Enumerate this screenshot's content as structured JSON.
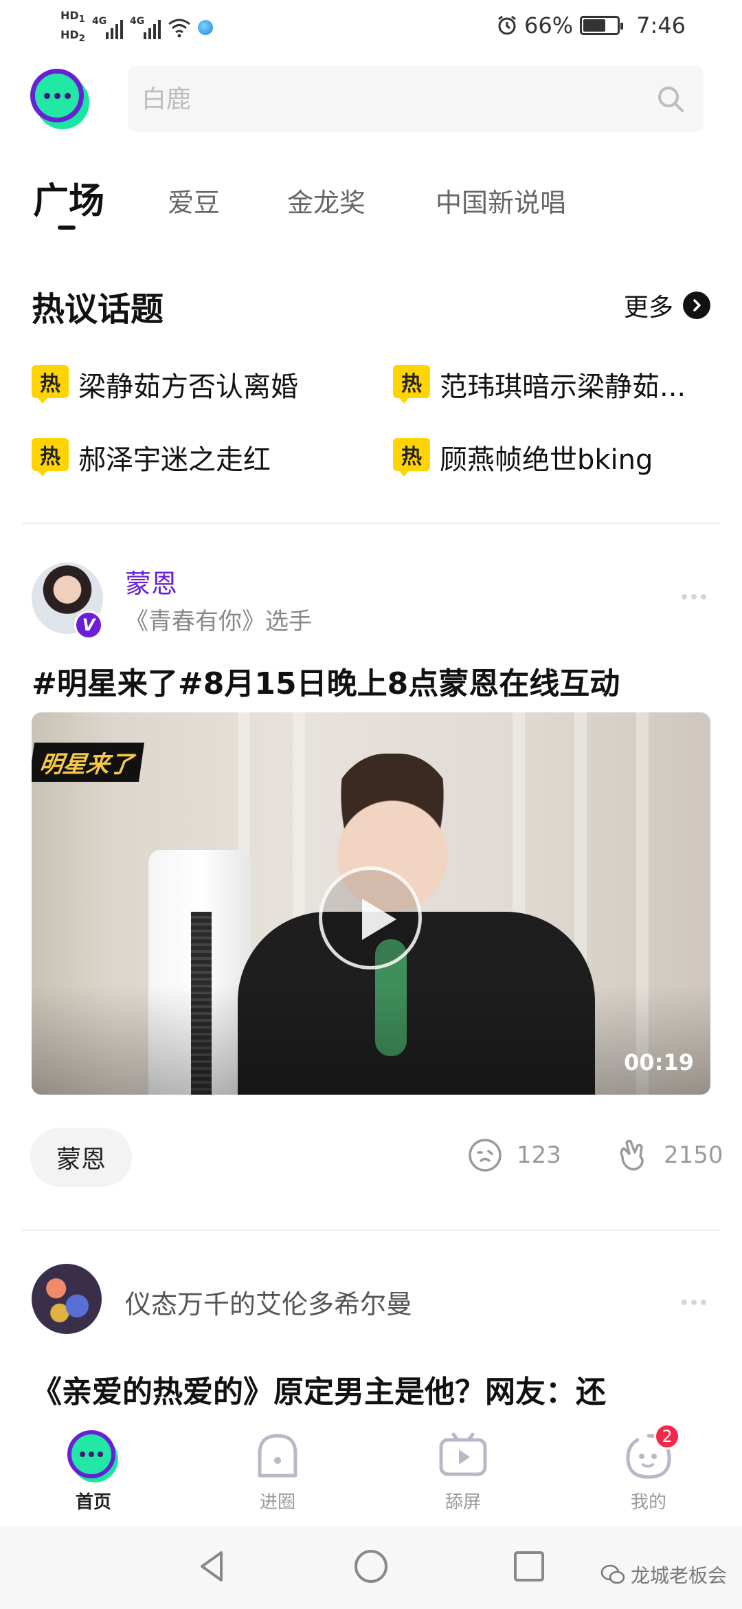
{
  "status_bar": {
    "hd1": "HD",
    "hd1_sub": "1",
    "hd2": "HD",
    "hd2_sub": "2",
    "net1": "4G",
    "net2": "4G",
    "battery_percent": "66%",
    "battery_level": 0.66,
    "time": "7:46",
    "icons": [
      "alarm-icon",
      "wifi-icon",
      "browser-icon",
      "battery-icon"
    ]
  },
  "header": {
    "logo_icon": "app-logo-icon",
    "search_placeholder": "白鹿",
    "search_icon": "search-icon"
  },
  "tabs": [
    {
      "label": "广场",
      "active": true
    },
    {
      "label": "爱豆",
      "active": false
    },
    {
      "label": "金龙奖",
      "active": false
    },
    {
      "label": "中国新说唱",
      "active": false
    }
  ],
  "hot_topics": {
    "title": "热议话题",
    "more_label": "更多",
    "badge_label": "热",
    "items": [
      {
        "text": "梁静茹方否认离婚"
      },
      {
        "text": "范玮琪暗示梁静茹..."
      },
      {
        "text": "郝泽宇迷之走红"
      },
      {
        "text": "顾燕帧绝世bking"
      }
    ]
  },
  "posts": [
    {
      "author": "蒙恩",
      "subtitle": "《青春有你》选手",
      "verified_label": "V",
      "title": "#明星来了#8月15日晚上8点蒙恩在线互动",
      "video": {
        "show_logo": "明星来了",
        "duration": "00:19"
      },
      "tag": "蒙恩",
      "comments": "123",
      "likes": "2150"
    },
    {
      "author": "仪态万千的艾伦多希尔曼",
      "title": "《亲爱的热爱的》原定男主是他？网友：还"
    }
  ],
  "bottom_nav": [
    {
      "label": "首页",
      "icon": "home-icon",
      "active": true
    },
    {
      "label": "进圈",
      "icon": "circle-icon",
      "active": false
    },
    {
      "label": "舔屏",
      "icon": "tv-icon",
      "active": false
    },
    {
      "label": "我的",
      "icon": "profile-icon",
      "active": false,
      "badge": "2"
    }
  ],
  "watermark": "龙城老板会",
  "colors": {
    "brand_purple": "#6a1fd6",
    "brand_green": "#22e7a5",
    "hot_yellow": "#ffd400",
    "badge_red": "#f5284a"
  }
}
